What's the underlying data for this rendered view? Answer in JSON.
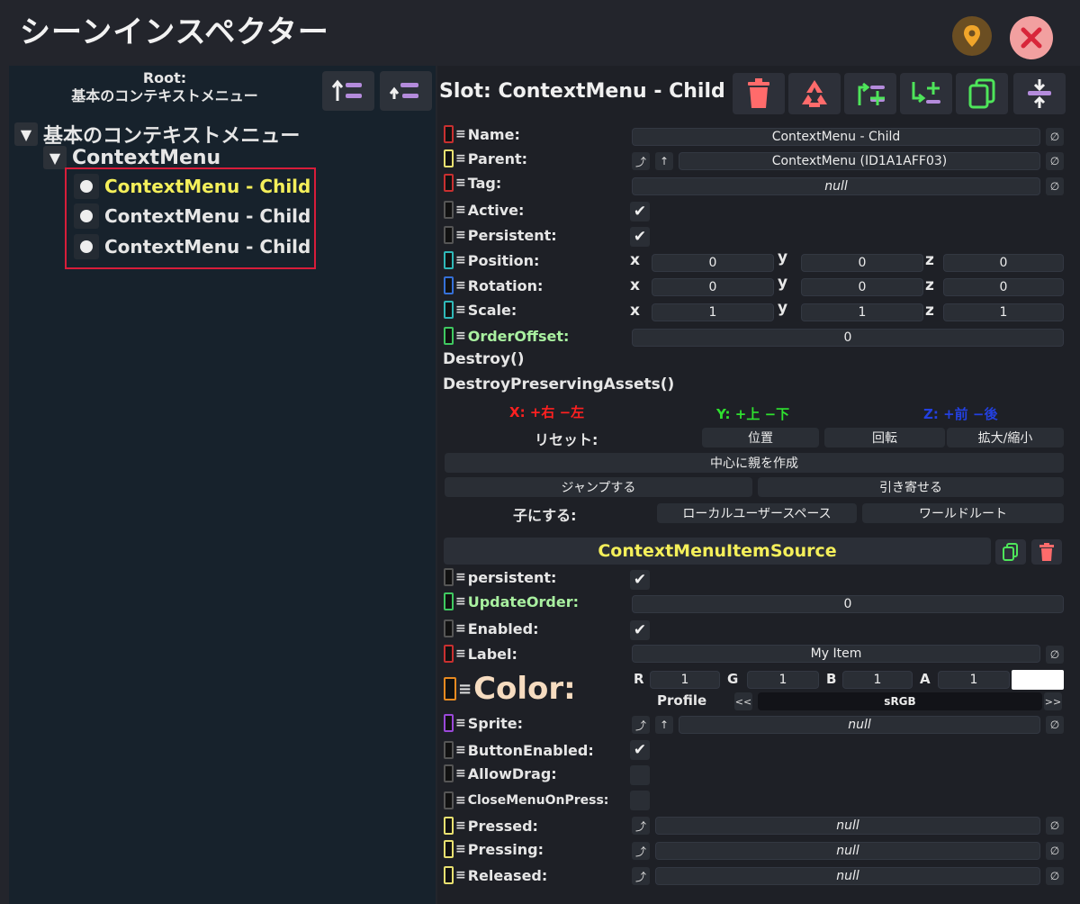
{
  "window": {
    "title": "シーンインスペクター",
    "pin_icon": "map-pin-icon",
    "close_icon": "close-icon"
  },
  "tree": {
    "root_label": "Root:",
    "root_name": "基本のコンテキストメニュー",
    "nodes": [
      {
        "label": "基本のコンテキストメニュー",
        "color": "#e6e6e6"
      },
      {
        "label": "ContextMenu",
        "color": "#e6e6e6"
      },
      {
        "label": "ContextMenu - Child",
        "color": "#f4ef5a"
      },
      {
        "label": "ContextMenu - Child",
        "color": "#e6e6e6"
      },
      {
        "label": "ContextMenu - Child",
        "color": "#e6e6e6"
      }
    ]
  },
  "slot": {
    "title": "Slot: ContextMenu - Child",
    "fields": {
      "name": {
        "label": "Name:",
        "value": "ContextMenu - Child"
      },
      "parent": {
        "label": "Parent:",
        "value": "ContextMenu (ID1A1AFF03)"
      },
      "tag": {
        "label": "Tag:",
        "value": "null"
      },
      "active": {
        "label": "Active:"
      },
      "persistent": {
        "label": "Persistent:"
      },
      "position": {
        "label": "Position:",
        "x": "0",
        "y": "0",
        "z": "0"
      },
      "rotation": {
        "label": "Rotation:",
        "x": "0",
        "y": "0",
        "z": "0"
      },
      "scale": {
        "label": "Scale:",
        "x": "1",
        "y": "1",
        "z": "1"
      },
      "order_offset": {
        "label": "OrderOffset:",
        "value": "0"
      }
    },
    "axes": {
      "x": "x",
      "y": "y",
      "z": "z"
    },
    "methods": {
      "destroy": "Destroy()",
      "destroy_preserving": "DestroyPreservingAssets()"
    },
    "axis_legend": {
      "x": "X: +右 −左",
      "y": "Y: +上 −下",
      "z": "Z: +前 −後"
    },
    "reset_label": "リセット:",
    "reset_buttons": {
      "position": "位置",
      "rotation": "回転",
      "scale": "拡大/縮小"
    },
    "create_parent": "中心に親を作成",
    "jump": "ジャンプする",
    "pull": "引き寄せる",
    "make_child_label": "子にする:",
    "local_user_space": "ローカルユーザースペース",
    "world_root": "ワールドルート"
  },
  "component": {
    "title": "ContextMenuItemSource",
    "fields": {
      "persistent": {
        "label": "persistent:"
      },
      "update_order": {
        "label": "UpdateOrder:",
        "value": "0"
      },
      "enabled": {
        "label": "Enabled:"
      },
      "label": {
        "label": "Label:",
        "value": "My Item"
      },
      "color": {
        "label": "Color:",
        "r": "1",
        "g": "1",
        "b": "1",
        "a": "1",
        "profile_label": "Profile",
        "profile_value": "sRGB",
        "prev": "<<",
        "next": ">>",
        "channels": {
          "r": "R",
          "g": "G",
          "b": "B",
          "a": "A"
        }
      },
      "sprite": {
        "label": "Sprite:",
        "value": "null"
      },
      "button_enabled": {
        "label": "ButtonEnabled:"
      },
      "allow_drag": {
        "label": "AllowDrag:"
      },
      "close_menu": {
        "label": "CloseMenuOnPress:"
      },
      "pressed": {
        "label": "Pressed:",
        "value": "null"
      },
      "pressing": {
        "label": "Pressing:",
        "value": "null"
      },
      "released": {
        "label": "Released:",
        "value": "null"
      }
    }
  },
  "glyphs": {
    "clear": "∅",
    "check": "✔",
    "triangle": "▼",
    "up": "↑",
    "jump": "⤴",
    "eq": "≡"
  }
}
